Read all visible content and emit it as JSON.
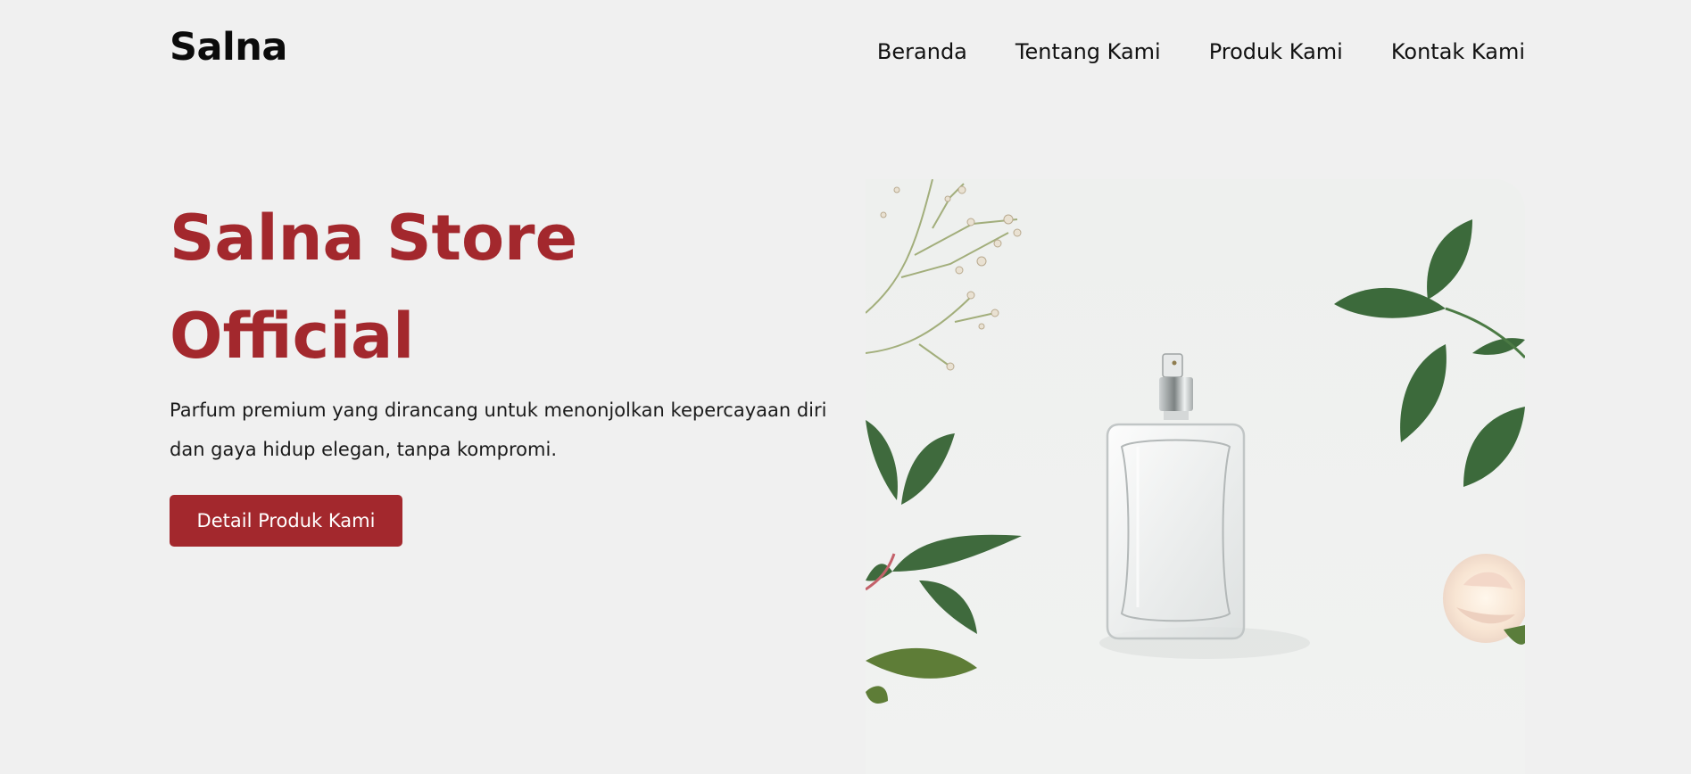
{
  "header": {
    "brand": "Salna",
    "nav": [
      "Beranda",
      "Tentang Kami",
      "Produk Kami",
      "Kontak Kami"
    ]
  },
  "hero": {
    "title_line1": "Salna Store",
    "title_line2": "Official",
    "description": "Parfum premium yang dirancang untuk menonjolkan kepercayaan diri dan gaya hidup elegan, tanpa kompromi.",
    "cta": "Detail Produk Kami",
    "image_icon": "perfume-bottle-icon"
  },
  "colors": {
    "background": "#f0f0f0",
    "accent": "#a3282d",
    "text": "#111111"
  }
}
